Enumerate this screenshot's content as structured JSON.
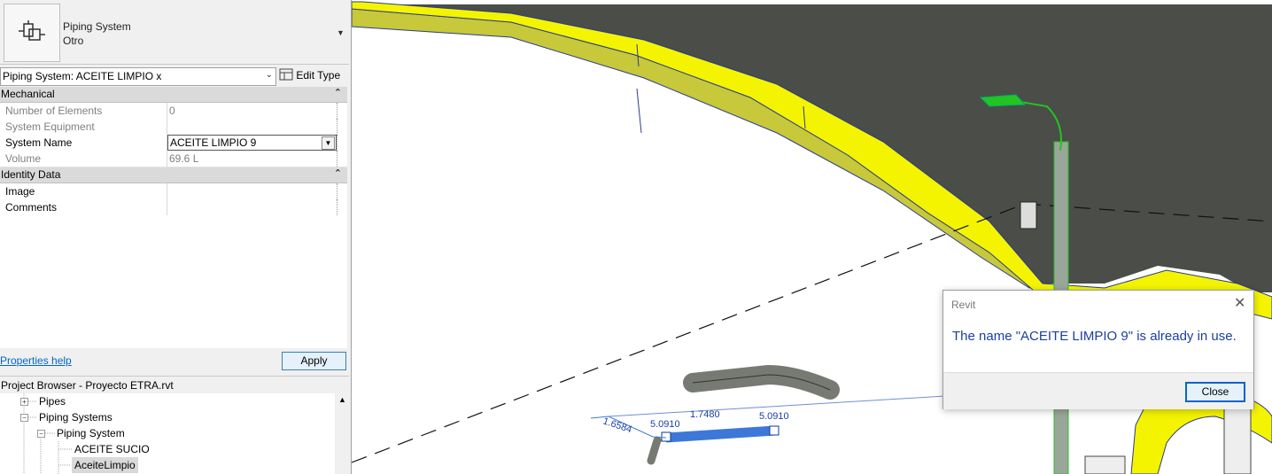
{
  "type_selector": {
    "family": "Piping System",
    "type": "Otro"
  },
  "properties": {
    "selector_label": "Piping System: ACEITE LIMPIO x",
    "edit_type_label": "Edit Type",
    "groups": {
      "mechanical": "Mechanical",
      "identity": "Identity Data"
    },
    "rows": {
      "num_elements": {
        "label": "Number of Elements",
        "value": "0"
      },
      "system_equipment": {
        "label": "System Equipment",
        "value": ""
      },
      "system_name": {
        "label": "System Name",
        "value": "ACEITE LIMPIO 9"
      },
      "volume": {
        "label": "Volume",
        "value": "69.6 L"
      },
      "image": {
        "label": "Image",
        "value": ""
      },
      "comments": {
        "label": "Comments",
        "value": ""
      }
    },
    "help_link": "Properties help",
    "apply_label": "Apply"
  },
  "project_browser": {
    "title": "Project Browser - Proyecto ETRA.rvt",
    "nodes": {
      "pipes": "Pipes",
      "piping_systems": "Piping Systems",
      "piping_system": "Piping System",
      "aceite_sucio": "ACEITE SUCIO",
      "aceite_limpio": "AceiteLimpio"
    }
  },
  "viewport": {
    "dimensions": [
      "1.6584",
      "5.0910",
      "1.7480",
      "5.0910"
    ],
    "colors": {
      "road_yellow": "#f4f400",
      "road_side": "#c7c83a",
      "surface": "#4a4d48",
      "pipe": "#3d78d8",
      "pole_green": "#22c422"
    }
  },
  "dialog": {
    "title": "Revit",
    "message": "The name \"ACEITE LIMPIO 9\" is already in use.",
    "close_label": "Close"
  }
}
